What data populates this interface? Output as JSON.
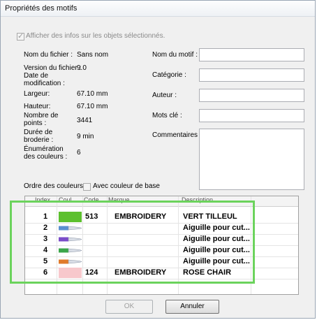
{
  "window": {
    "title": "Propriétés des motifs"
  },
  "show_info": {
    "label": "Afficher des infos sur les objets sélectionnés.",
    "checked": true
  },
  "info": {
    "file_name_label": "Nom du fichier :",
    "file_name_value": "Sans nom",
    "version_label": "Version du fichier :",
    "version_value": "9.0",
    "date_label": "Date de modification :",
    "width_label": "Largeur:",
    "width_value": "67.10 mm",
    "height_label": "Hauteur:",
    "height_value": "67.10 mm",
    "points_label": "Nombre de points :",
    "points_value": "3441",
    "duration_label": "Durée de broderie :",
    "duration_value": "9 min",
    "colors_label": "Énumération des couleurs :",
    "colors_value": "6"
  },
  "form": {
    "motif_name_label": "Nom du motif :",
    "category_label": "Catégorie :",
    "author_label": "Auteur :",
    "keywords_label": "Mots clé :",
    "comments_label": "Commentaires :"
  },
  "color_order": {
    "label": "Ordre des couleurs:",
    "base_color_label": "Avec couleur de base",
    "base_color_checked": false
  },
  "table": {
    "columns": [
      "Index",
      "Coul.",
      "Code",
      "Marque",
      "Description"
    ],
    "rows": [
      {
        "index": "1",
        "swatch": "#5cc02e",
        "kind": "swatch",
        "code": "513",
        "brand": "EMBROIDERY",
        "description": "VERT TILLEUL"
      },
      {
        "index": "2",
        "needle": "#5a8fd0",
        "kind": "needle",
        "code": "",
        "brand": "",
        "description": "Aiguille pour cut..."
      },
      {
        "index": "3",
        "needle": "#7a4cc8",
        "kind": "needle",
        "code": "",
        "brand": "",
        "description": "Aiguille pour cut..."
      },
      {
        "index": "4",
        "needle": "#3aa54a",
        "kind": "needle",
        "code": "",
        "brand": "",
        "description": "Aiguille pour cut..."
      },
      {
        "index": "5",
        "needle": "#e07a2a",
        "kind": "needle",
        "code": "",
        "brand": "",
        "description": "Aiguille pour cut..."
      },
      {
        "index": "6",
        "swatch": "#f7c8cc",
        "kind": "swatch",
        "code": "124",
        "brand": "EMBROIDERY",
        "description": "ROSE CHAIR"
      }
    ]
  },
  "buttons": {
    "ok": "OK",
    "cancel": "Annuler"
  },
  "colors": {
    "highlight": "#6bd35c"
  }
}
